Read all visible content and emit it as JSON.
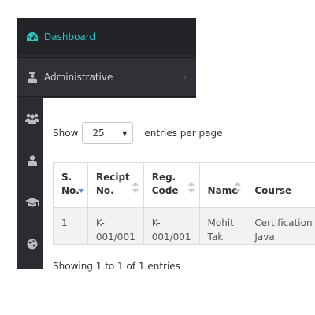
{
  "sidebar": {
    "items": [
      {
        "label": "Dashboard",
        "icon": "dashboard-icon"
      },
      {
        "label": "Administrative",
        "icon": "admin-icon"
      },
      {
        "label": "",
        "icon": "users-icon"
      },
      {
        "label": "",
        "icon": "user-icon"
      },
      {
        "label": "",
        "icon": "graduation-cap-icon"
      },
      {
        "label": "",
        "icon": "globe-icon"
      }
    ],
    "chevron": "›",
    "accent": "#2ec4c4"
  },
  "table_controls": {
    "show_label": "Show",
    "page_length": "25",
    "after_label": "entries per page"
  },
  "table": {
    "columns": [
      {
        "line1": "S.",
        "line2": "No."
      },
      {
        "line1": "Recipt",
        "line2": "No."
      },
      {
        "line1": "Reg.",
        "line2": "Code"
      },
      {
        "line1": "Name",
        "line2": ""
      },
      {
        "line1": "Course",
        "line2": ""
      }
    ],
    "rows": [
      {
        "sno": "1",
        "recipt": "K-001/001",
        "reg": "K-001/001",
        "name_line1": "Mohit",
        "name_line2": "Tak",
        "course_line1": "Certification",
        "course_line2": "Java"
      }
    ]
  },
  "info_text": "Showing 1 to 1 of 1 entries"
}
